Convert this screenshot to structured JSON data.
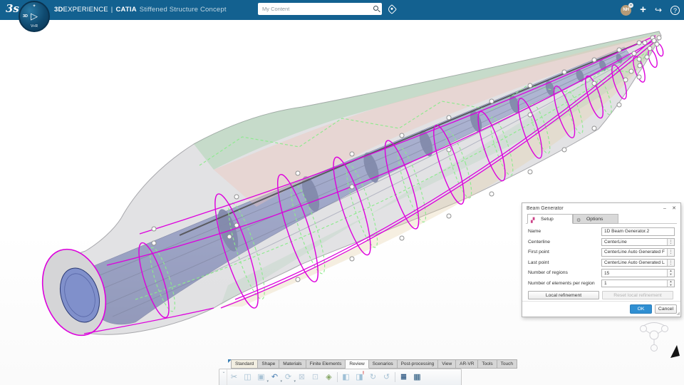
{
  "header": {
    "logo": "3s",
    "compass": {
      "north": "✦",
      "west": "3D",
      "south": "V+R",
      "play": "▷"
    },
    "title": {
      "brand_bold": "3D",
      "brand": "EXPERIENCE",
      "divider": "|",
      "app": "CATIA",
      "document": "Stiffened Structure Concept"
    },
    "search": {
      "placeholder": "My Content"
    },
    "actions": {
      "add": "+",
      "share": "↪",
      "help": "?"
    },
    "user": {
      "initials": "NH"
    }
  },
  "dialog": {
    "title": "Beam Generator",
    "minimize": "–",
    "close": "✕",
    "tabs": [
      {
        "label": "Setup",
        "icon": "▞"
      },
      {
        "label": "Options",
        "icon": "⚙"
      }
    ],
    "fields": [
      {
        "label": "Name",
        "value": "1D Beam Generator.2"
      },
      {
        "label": "Centerline",
        "value": "CenterLine"
      },
      {
        "label": "First point",
        "value": "CenterLine Auto Generated First ..."
      },
      {
        "label": "Last point",
        "value": "CenterLine Auto Generated Last ..."
      },
      {
        "label": "Number of regions",
        "value": "15"
      },
      {
        "label": "Number of elements per region",
        "value": "1"
      }
    ],
    "buttons": {
      "local": "Local refinement",
      "reset": "Reset local refinement",
      "ok": "OK",
      "cancel": "Cancel"
    }
  },
  "action_bar": {
    "overflow": "⌄",
    "tabs": [
      {
        "label": "Standard"
      },
      {
        "label": "Shape"
      },
      {
        "label": "Materials"
      },
      {
        "label": "Finite Elements"
      },
      {
        "label": "Review"
      },
      {
        "label": "Scenarios"
      },
      {
        "label": "Post-processing"
      },
      {
        "label": "View"
      },
      {
        "label": "AR-VR"
      },
      {
        "label": "Tools"
      },
      {
        "label": "Touch"
      }
    ],
    "icons": [
      {
        "name": "cut",
        "glyph": "✂"
      },
      {
        "name": "copy",
        "glyph": "◫"
      },
      {
        "name": "paste",
        "glyph": "▣",
        "caret": "▾"
      },
      {
        "name": "undo",
        "glyph": "↶",
        "caret": "▾"
      },
      {
        "name": "update",
        "glyph": "⟳",
        "caret": "▾"
      },
      {
        "name": "no-update",
        "glyph": "⊠"
      },
      {
        "name": "import-update",
        "glyph": "⊡"
      },
      {
        "name": "manage-views",
        "glyph": "◈"
      },
      {
        "name": "panel-layout",
        "glyph": "◧"
      },
      {
        "name": "alert-panel",
        "glyph": "◨",
        "badge": "!"
      },
      {
        "name": "refresh",
        "glyph": "↻"
      },
      {
        "name": "sync",
        "glyph": "↺"
      },
      {
        "name": "layer-stack",
        "glyph": "≣"
      },
      {
        "name": "data-table",
        "glyph": "▦"
      }
    ]
  },
  "colors": {
    "topbar": "#136190",
    "accent_blue": "#2f8fd2",
    "magenta": "#dd00dd",
    "spar_blue": "#6b7cc4",
    "dashed_green": "#8deb8d",
    "surface_gray": "#cbcbce"
  }
}
